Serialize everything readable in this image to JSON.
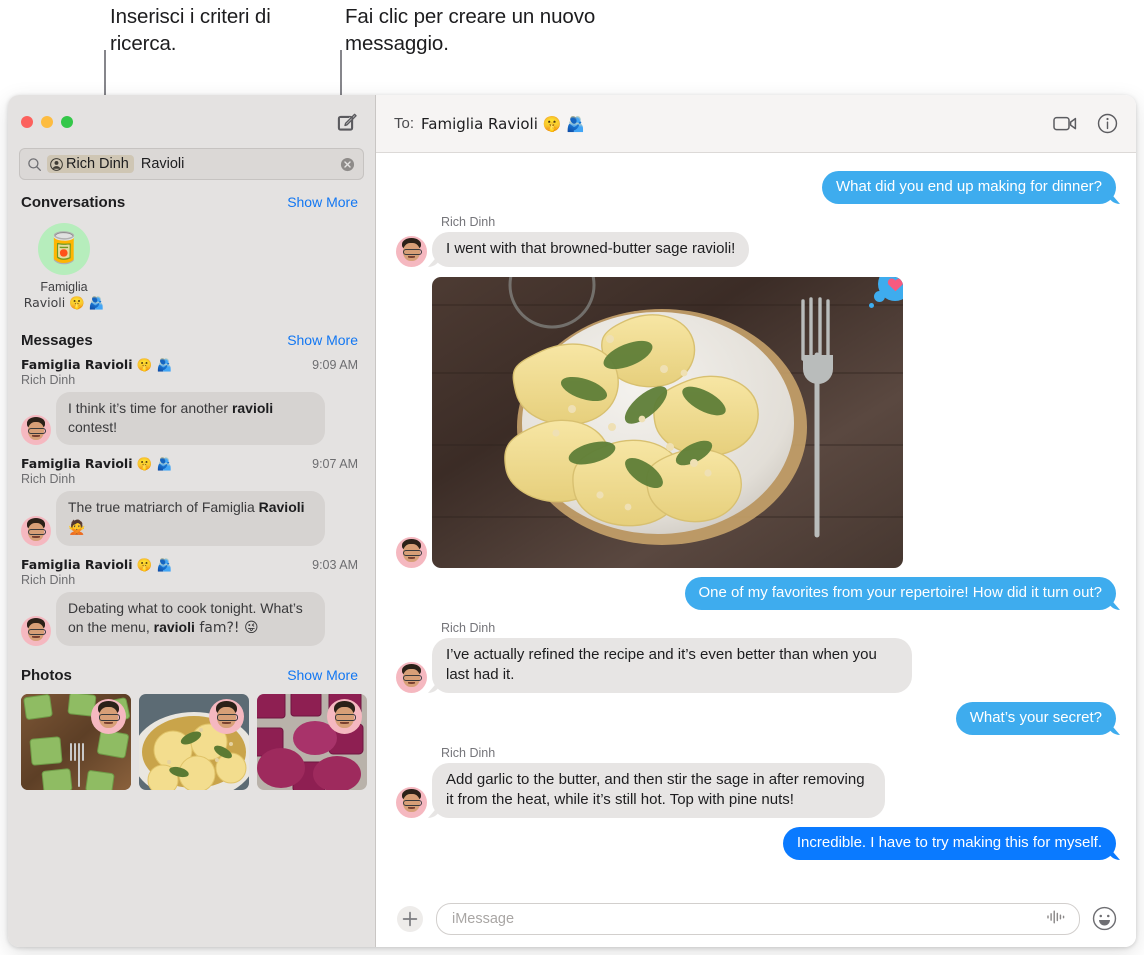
{
  "callouts": [
    {
      "text": "Inserisci i criteri di ricerca."
    },
    {
      "text": "Fai clic per creare un nuovo messaggio."
    }
  ],
  "window": {
    "traffic": {
      "close": "close-button",
      "minimize": "minimize-button",
      "zoom": "zoom-button"
    },
    "compose_tooltip": "New Message"
  },
  "search": {
    "token_label": "Rich Dinh",
    "query_text": "Ravioli",
    "placeholder": "Search"
  },
  "sidebar": {
    "sections": [
      {
        "title": "Conversations",
        "action": "Show More"
      },
      {
        "title": "Messages",
        "action": "Show More"
      },
      {
        "title": "Photos",
        "action": "Show More"
      }
    ],
    "conversations": [
      {
        "name_line1": "Famiglia",
        "name_line2": "Ravioli 🤫 🫂",
        "avatar_emoji": "🥫"
      }
    ],
    "messages": [
      {
        "thread": "Famiglia Ravioli 🤫 🫂",
        "sender": "Rich Dinh",
        "time": "9:09 AM",
        "preview_pre": "I think it’s time for another ",
        "preview_match": "ravioli",
        "preview_post": " contest!"
      },
      {
        "thread": "Famiglia Ravioli 🤫 🫂",
        "sender": "Rich Dinh",
        "time": "9:07 AM",
        "preview_pre": "The true matriarch of Famiglia ",
        "preview_match": "Ravioli",
        "preview_post": " 🙅"
      },
      {
        "thread": "Famiglia Ravioli 🤫 🫂",
        "sender": "Rich Dinh",
        "time": "9:03 AM",
        "preview_pre": "Debating what to cook tonight. What’s on the menu, ",
        "preview_match": "ravioli",
        "preview_post": " fam?! 😜"
      }
    ],
    "photos": [
      {
        "alt": "green-spinach-ravioli-photo"
      },
      {
        "alt": "browned-butter-sage-ravioli-photo"
      },
      {
        "alt": "beet-ravioli-photo"
      }
    ]
  },
  "conversation": {
    "to_label": "To:",
    "to_value": "Famiglia Ravioli 🤫 🫂",
    "facetime_icon": "video-camera-icon",
    "details_icon": "info-icon",
    "messages": [
      {
        "side": "outgoing",
        "text": "What did you end up making for dinner?",
        "tone": "light"
      },
      {
        "side": "incoming",
        "sender": "Rich Dinh",
        "text": "I went with that browned-butter sage ravioli!"
      },
      {
        "side": "incoming",
        "type": "image",
        "alt": "plate-of-ravioli-with-sage-photo",
        "tapback": "heart"
      },
      {
        "side": "outgoing",
        "text": "One of my favorites from your repertoire! How did it turn out?",
        "tone": "light"
      },
      {
        "side": "incoming",
        "sender": "Rich Dinh",
        "text": "I’ve actually refined the recipe and it’s even better than when you last had it."
      },
      {
        "side": "outgoing",
        "text": "What’s your secret?",
        "tone": "light"
      },
      {
        "side": "incoming",
        "sender": "Rich Dinh",
        "text": "Add garlic to the butter, and then stir the sage in after removing it from the heat, while it’s still hot. Top with pine nuts!"
      },
      {
        "side": "outgoing",
        "text": "Incredible. I have to try making this for myself.",
        "tone": "strong"
      }
    ],
    "composer": {
      "add_icon": "plus-icon",
      "placeholder": "iMessage",
      "audio_icon": "audio-waveform-icon",
      "emoji_icon": "smiley-icon"
    }
  },
  "colors": {
    "accent_blue": "#0a7aff",
    "light_blue": "#3eacee",
    "link_blue": "#1277f2",
    "sidebar_bg": "#e4e2e1",
    "bubble_gray": "#e7e5e4"
  }
}
